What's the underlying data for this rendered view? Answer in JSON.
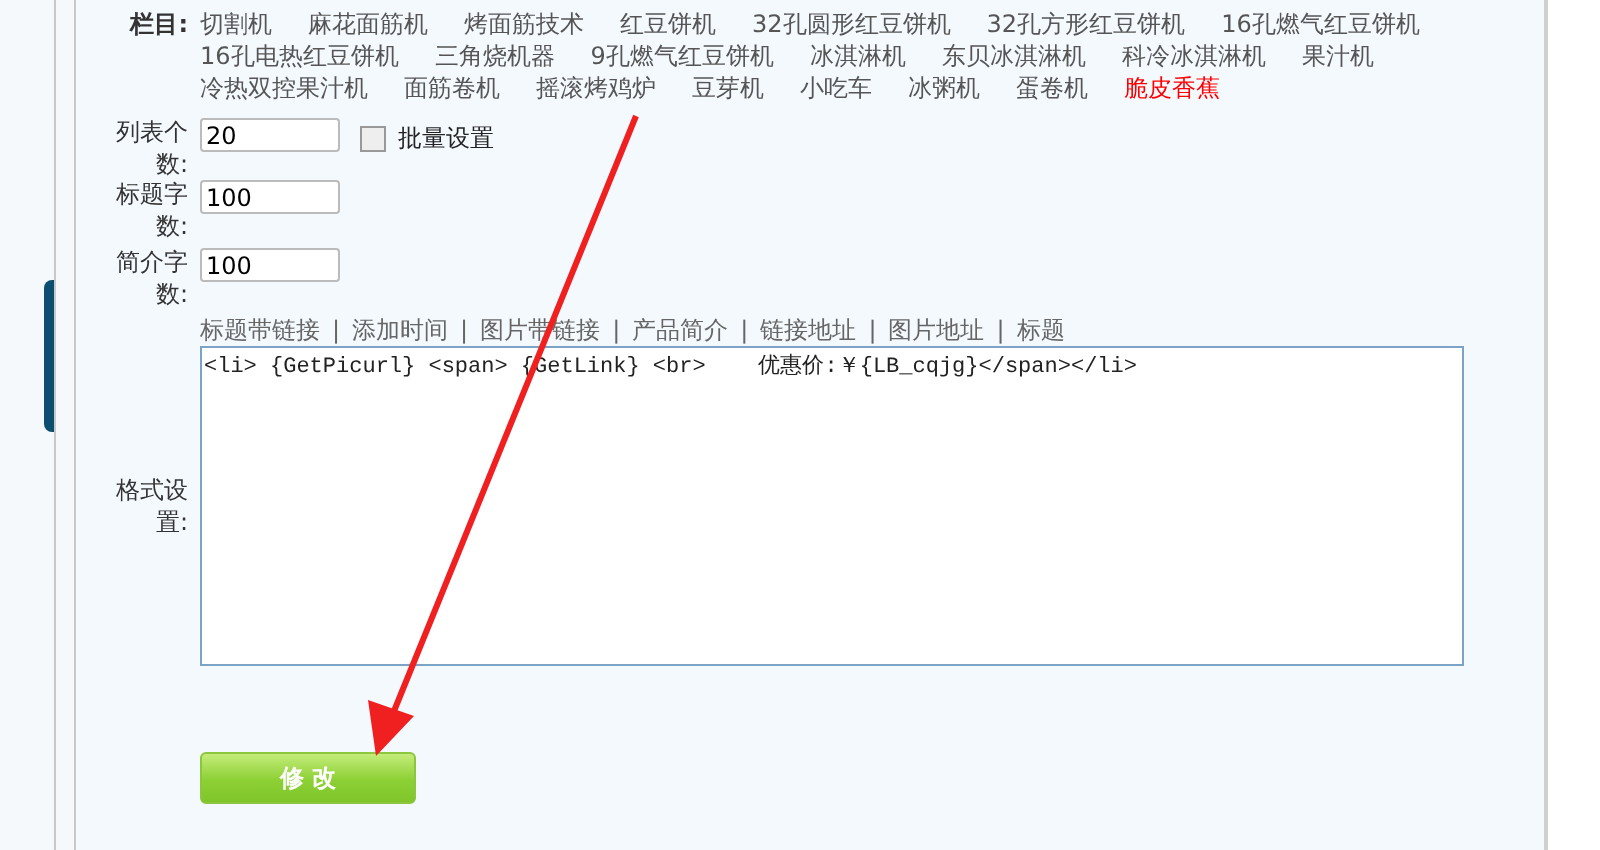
{
  "column_field": {
    "label": "栏目:",
    "categories": [
      {
        "label": "切割机",
        "selected": false
      },
      {
        "label": "麻花面筋机",
        "selected": false
      },
      {
        "label": "烤面筋技术",
        "selected": false
      },
      {
        "label": "红豆饼机",
        "selected": false
      },
      {
        "label": "32孔圆形红豆饼机",
        "selected": false
      },
      {
        "label": "32孔方形红豆饼机",
        "selected": false
      },
      {
        "label": "16孔燃气红豆饼机",
        "selected": false
      },
      {
        "label": "16孔电热红豆饼机",
        "selected": false
      },
      {
        "label": "三角烧机器",
        "selected": false
      },
      {
        "label": "9孔燃气红豆饼机",
        "selected": false
      },
      {
        "label": "冰淇淋机",
        "selected": false
      },
      {
        "label": "东贝冰淇淋机",
        "selected": false
      },
      {
        "label": "科冷冰淇淋机",
        "selected": false
      },
      {
        "label": "果汁机",
        "selected": false
      },
      {
        "label": "冷热双控果汁机",
        "selected": false
      },
      {
        "label": "面筋卷机",
        "selected": false
      },
      {
        "label": "摇滚烤鸡炉",
        "selected": false
      },
      {
        "label": "豆芽机",
        "selected": false
      },
      {
        "label": "小吃车",
        "selected": false
      },
      {
        "label": "冰粥机",
        "selected": false
      },
      {
        "label": "蛋卷机",
        "selected": false
      },
      {
        "label": "脆皮香蕉",
        "selected": true
      }
    ]
  },
  "number_fields": [
    {
      "label": "列表个数:",
      "value": "20",
      "batch": {
        "label": "批量设置",
        "checked": false
      }
    },
    {
      "label": "标题字数:",
      "value": "100"
    },
    {
      "label": "简介字数:",
      "value": "100"
    }
  ],
  "format_field": {
    "label": "格式设置:",
    "tags": [
      "标题带链接",
      "添加时间",
      "图片带链接",
      "产品简介",
      "链接地址",
      "图片地址",
      "标题"
    ],
    "separator": "|",
    "value": "<li> {GetPicurl} <span> {GetLink} <br>    优惠价:￥{LB_cqjg}</span></li>"
  },
  "submit_button": {
    "label": "修 改"
  }
}
